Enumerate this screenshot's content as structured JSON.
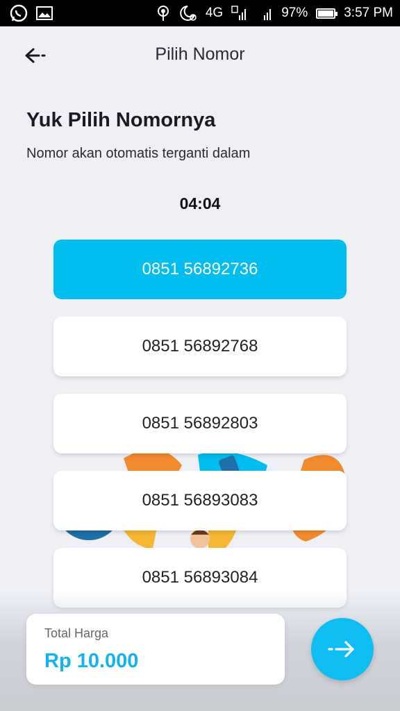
{
  "status_bar": {
    "network": "4G",
    "sim1": "1",
    "sim2": "2",
    "battery": "97%",
    "time": "3:57 PM"
  },
  "app_bar": {
    "title": "Pilih Nomor"
  },
  "heading": "Yuk Pilih Nomornya",
  "subtext": "Nomor akan otomatis terganti dalam",
  "timer": "04:04",
  "numbers": [
    {
      "value": "0851 56892736",
      "selected": true
    },
    {
      "value": "0851 56892768",
      "selected": false
    },
    {
      "value": "0851 56892803",
      "selected": false
    },
    {
      "value": "0851 56893083",
      "selected": false
    },
    {
      "value": "0851 56893084",
      "selected": false
    }
  ],
  "total": {
    "label": "Total Harga",
    "value": "Rp 10.000"
  },
  "colors": {
    "accent": "#00bdf0",
    "price": "#13b3ec",
    "background": "#eef0f6"
  }
}
